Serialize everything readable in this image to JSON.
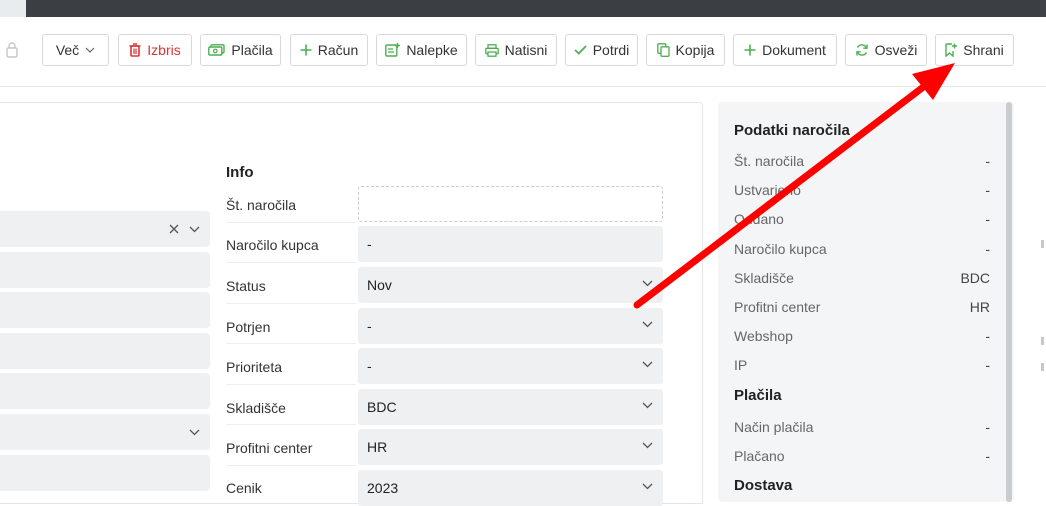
{
  "toolbar": {
    "more_label": "Več",
    "delete_label": "Izbris",
    "payments_label": "Plačila",
    "invoice_label": "Račun",
    "labels_label": "Nalepke",
    "print_label": "Natisni",
    "confirm_label": "Potrdi",
    "copy_label": "Kopija",
    "document_label": "Dokument",
    "refresh_label": "Osveži",
    "save_label": "Shrani"
  },
  "info": {
    "title": "Info",
    "rows": [
      {
        "label": "Št. naročila",
        "value": ""
      },
      {
        "label": "Naročilo kupca",
        "value": "-"
      },
      {
        "label": "Status",
        "value": "Nov"
      },
      {
        "label": "Potrjen",
        "value": "-"
      },
      {
        "label": "Prioriteta",
        "value": "-"
      },
      {
        "label": "Skladišče",
        "value": "BDC"
      },
      {
        "label": "Profitni center",
        "value": "HR"
      },
      {
        "label": "Cenik",
        "value": "2023"
      }
    ]
  },
  "sidebar": {
    "order_title": "Podatki naročila",
    "order_rows": [
      {
        "label": "Št. naročila",
        "value": "-"
      },
      {
        "label": "Ustvarjeno",
        "value": "-"
      },
      {
        "label": "Oddano",
        "value": "-"
      },
      {
        "label": "Naročilo kupca",
        "value": "-"
      },
      {
        "label": "Skladišče",
        "value": "BDC"
      },
      {
        "label": "Profitni center",
        "value": "HR"
      },
      {
        "label": "Webshop",
        "value": "-"
      },
      {
        "label": "IP",
        "value": "-"
      }
    ],
    "payments_title": "Plačila",
    "payment_rows": [
      {
        "label": "Način plačila",
        "value": "-"
      },
      {
        "label": "Plačano",
        "value": "-"
      }
    ],
    "delivery_title": "Dostava"
  },
  "colors": {
    "accent_green": "#4caf50",
    "danger_red": "#dd3333",
    "annotation_arrow": "#ff0000"
  }
}
